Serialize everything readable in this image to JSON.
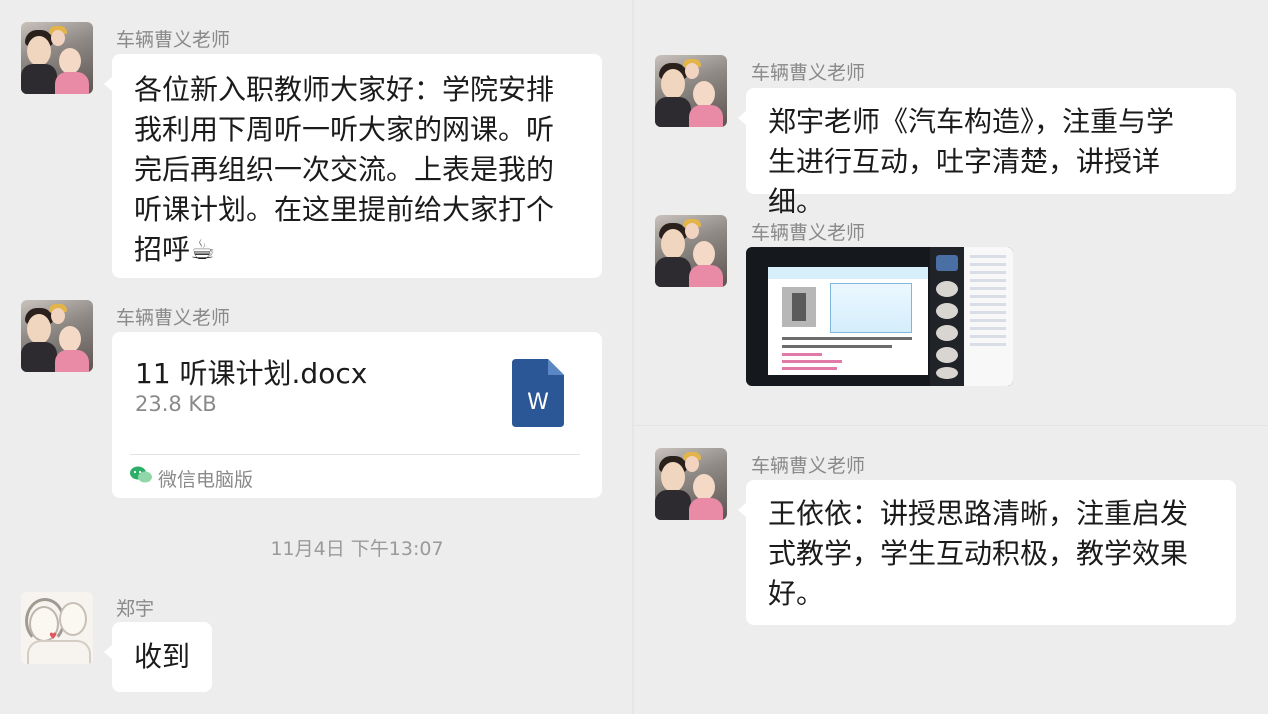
{
  "left_column": {
    "messages": [
      {
        "sender": "车辆曹义老师",
        "lines": [
          "各位新入职教师大家好：学院安排",
          "我利用下周听一听大家的网课。听",
          "完后再组织一次交流。上表是我的",
          "听课计划。在这里提前给大家打个",
          "招呼☕"
        ]
      },
      {
        "sender": "车辆曹义老师",
        "file": {
          "name": "11 听课计划.docx",
          "size": "23.8 KB",
          "icon_letter": "W",
          "icon_color": "#2b5797",
          "source": "微信电脑版"
        }
      }
    ],
    "timestamp": "11月4日 下午13:07",
    "reply": {
      "sender": "郑宇",
      "text": "收到"
    }
  },
  "right_column": {
    "messages": [
      {
        "sender": "车辆曹义老师",
        "lines": [
          "郑宇老师《汽车构造》，注重与学",
          "生进行互动，吐字清楚，讲授详细。"
        ]
      },
      {
        "sender": "车辆曹义老师",
        "media": "video-meeting-screenshot"
      },
      {
        "sender": "车辆曹义老师",
        "lines": [
          "王依依：讲授思路清晰，注重启发",
          "式教学，学生互动积极，教学效果",
          "好。"
        ]
      }
    ]
  },
  "colors": {
    "background": "#ededed",
    "bubble": "#ffffff",
    "name_text": "#8a8a8a",
    "word_blue": "#2b5797",
    "wechat_green": "#2bae67"
  }
}
